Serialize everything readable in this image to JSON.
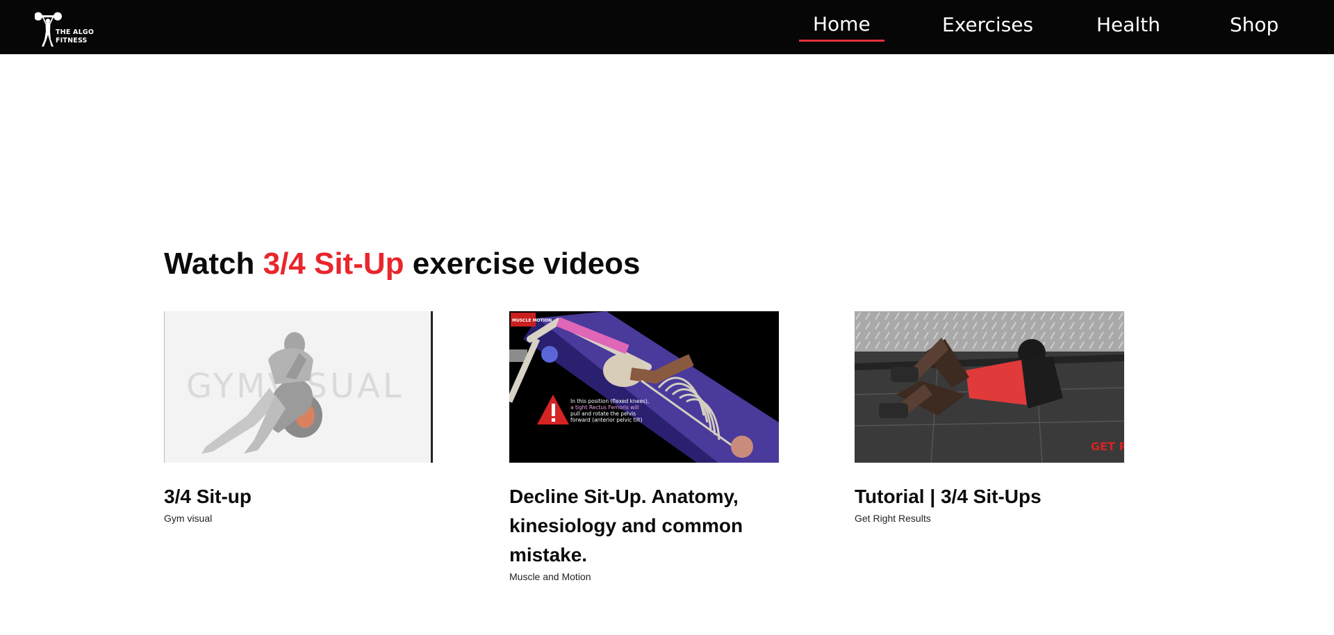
{
  "brand": {
    "line1": "THE ALGO",
    "line2": "FITNESS"
  },
  "nav": {
    "home": "Home",
    "exercises": "Exercises",
    "health": "Health",
    "shop": "Shop"
  },
  "heading": {
    "prefix": "Watch ",
    "exercise": "3/4 Sit-Up",
    "suffix": " exercise videos"
  },
  "videos": [
    {
      "title": "3/4 Sit-up",
      "channel": "Gym visual",
      "thumb_text": "GYMVISUAL"
    },
    {
      "title": "Decline Sit-Up. Anatomy, kinesiology and common mistake.",
      "channel": "Muscle and Motion",
      "thumb_badge": "MUSCLE MOTION",
      "thumb_note": [
        "In this position (flexed knees),",
        "a tight Rectus Femoris will",
        "pull and rotate the pelvis",
        "forward (anterior pelvic tilt)"
      ]
    },
    {
      "title": "Tutorial | 3/4 Sit-Ups",
      "channel": "Get Right Results",
      "thumb_text": "GET R"
    }
  ],
  "colors": {
    "accent": "#e8262c",
    "navbar": "#060606"
  }
}
